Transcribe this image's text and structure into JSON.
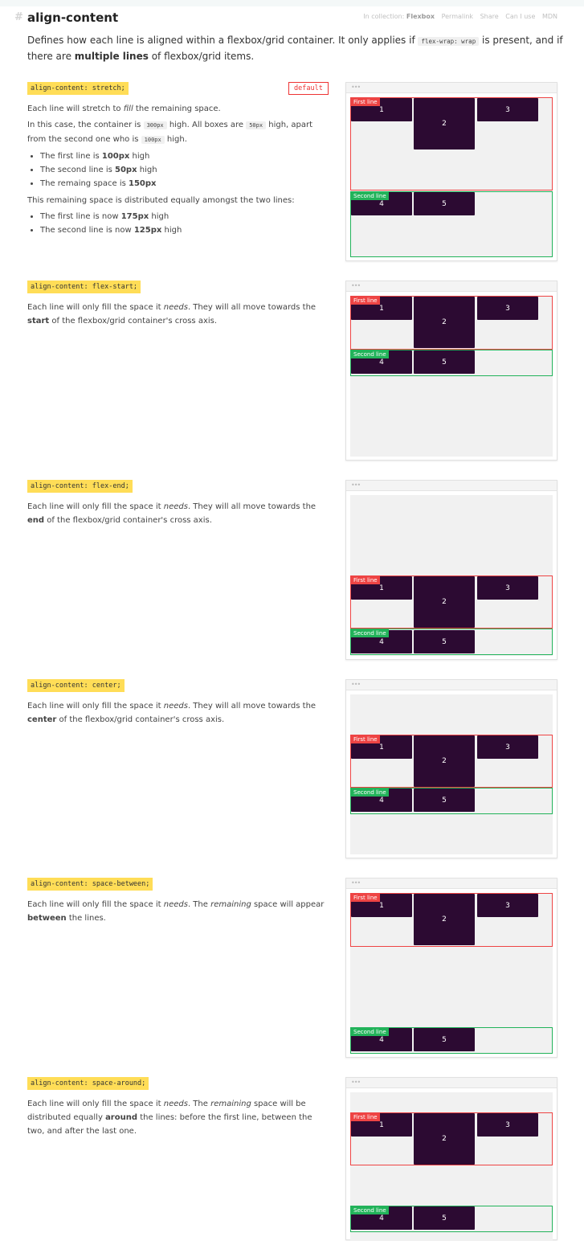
{
  "header": {
    "hash": "#",
    "title": "align-content",
    "collection_prefix": "In collection:",
    "collection_name": "Flexbox",
    "links": [
      "Permalink",
      "Share",
      "Can I use",
      "MDN"
    ]
  },
  "intro": {
    "t1": "Defines how each line is aligned within a flexbox/grid container. It only applies if ",
    "code": "flex-wrap: wrap",
    "t2": " is present, and if there are ",
    "bold": "multiple lines",
    "t3": " of flexbox/grid items."
  },
  "demo": {
    "dots": "•••",
    "first_line_label": "First line",
    "second_line_label": "Second line",
    "box_labels": [
      "1",
      "2",
      "3",
      "4",
      "5"
    ]
  },
  "sections": [
    {
      "code": "align-content: stretch;",
      "default_label": "default",
      "p1": {
        "t1": "Each line will stretch to ",
        "em": "fill",
        "t2": " the remaining space."
      },
      "p2": {
        "t1": "In this case, the container is ",
        "c1": "300px",
        "t2": " high. All boxes are ",
        "c2": "50px",
        "t3": " high, apart from the second one who is ",
        "c3": "100px",
        "t4": " high."
      },
      "list1": [
        {
          "t": "The first line is ",
          "b": "100px",
          "t2": " high"
        },
        {
          "t": "The second line is ",
          "b": "50px",
          "t2": " high"
        },
        {
          "t": "The remaing space is ",
          "b": "150px",
          "t2": ""
        }
      ],
      "p3": "This remaining space is distributed equally amongst the two lines:",
      "list2": [
        {
          "t": "The first line is now ",
          "b": "175px",
          "t2": " high"
        },
        {
          "t": "The second line is now ",
          "b": "125px",
          "t2": " high"
        }
      ]
    },
    {
      "code": "align-content: flex-start;",
      "t1": "Each line will only fill the space it ",
      "em": "needs",
      "t2": ". They will all move towards the ",
      "b": "start",
      "t3": " of the flexbox/grid container's cross axis."
    },
    {
      "code": "align-content: flex-end;",
      "t1": "Each line will only fill the space it ",
      "em": "needs",
      "t2": ". They will all move towards the ",
      "b": "end",
      "t3": " of the flexbox/grid container's cross axis."
    },
    {
      "code": "align-content: center;",
      "t1": "Each line will only fill the space it ",
      "em": "needs",
      "t2": ". They will all move towards the ",
      "b": "center",
      "t3": " of the flexbox/grid container's cross axis."
    },
    {
      "code": "align-content: space-between;",
      "t1": "Each line will only fill the space it ",
      "em": "needs",
      "t2": ". The ",
      "em2": "remaining",
      "t3": " space will appear ",
      "b": "between",
      "t4": " the lines."
    },
    {
      "code": "align-content: space-around;",
      "t1": "Each line will only fill the space it ",
      "em": "needs",
      "t2": ". The ",
      "em2": "remaining",
      "t3": " space will be distributed equally ",
      "b": "around",
      "t4": " the lines: before the first line, between the two, and after the last one."
    }
  ]
}
